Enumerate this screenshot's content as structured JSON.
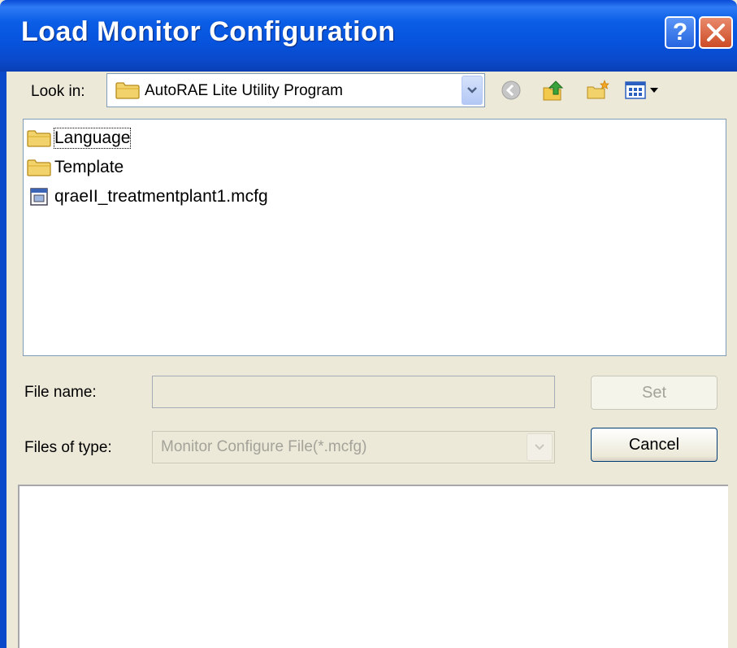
{
  "window": {
    "title": "Load Monitor Configuration",
    "help_label": "?",
    "close_label": "✕"
  },
  "look_in": {
    "label": "Look in:",
    "value": "AutoRAE Lite Utility Program"
  },
  "toolbar": {
    "icons": [
      "back-icon",
      "up-folder-icon",
      "new-folder-icon",
      "view-menu-icon"
    ]
  },
  "files": [
    {
      "name": "Language",
      "icon": "folder-icon"
    },
    {
      "name": "Template",
      "icon": "folder-icon"
    },
    {
      "name": "qraeII_treatmentplant1.mcfg",
      "icon": "config-file-icon"
    }
  ],
  "file_name": {
    "label": "File name:",
    "value": ""
  },
  "file_type": {
    "label": "Files of type:",
    "value": "Monitor Configure File(*.mcfg)"
  },
  "buttons": {
    "set": "Set",
    "cancel": "Cancel"
  },
  "colors": {
    "title_bar": "#0753dd",
    "dialog_bg": "#ece9d8",
    "close_button": "#cc4b26"
  }
}
